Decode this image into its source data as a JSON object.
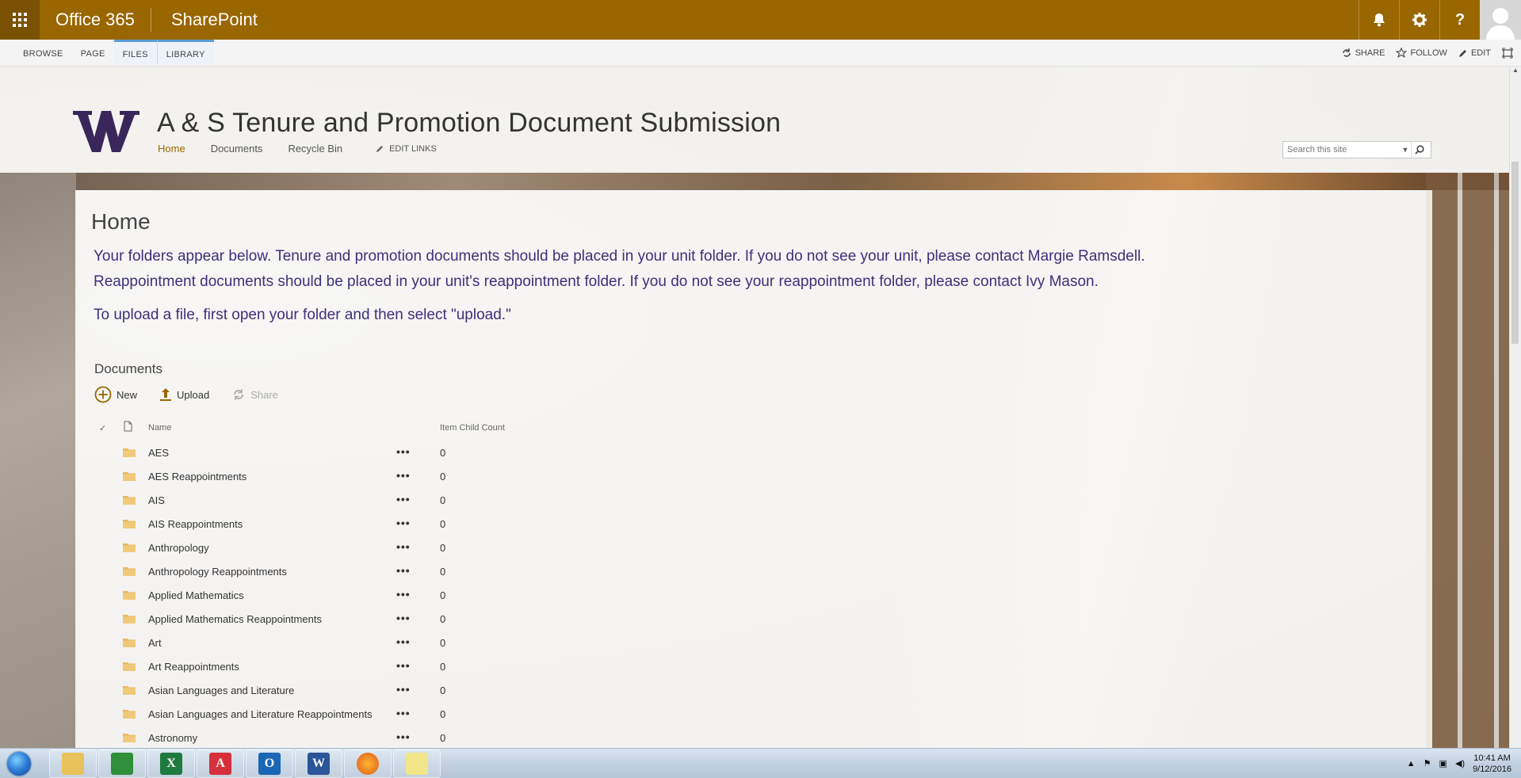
{
  "suitebar": {
    "brand": "Office 365",
    "product": "SharePoint",
    "icons": [
      "bell-icon",
      "gear-icon",
      "help-icon",
      "avatar"
    ],
    "help_label": "?",
    "colors": {
      "bar": "#996600",
      "waffle_bg": "#7a5100"
    }
  },
  "ribbon": {
    "tabs": [
      "BROWSE",
      "PAGE",
      "FILES",
      "LIBRARY"
    ],
    "actions": {
      "share": "SHARE",
      "follow": "FOLLOW",
      "edit": "EDIT"
    }
  },
  "site": {
    "title": "A & S Tenure and Promotion Document Submission",
    "nav": {
      "home": "Home",
      "documents": "Documents",
      "recycle": "Recycle Bin",
      "edit_links": "EDIT LINKS"
    },
    "search_placeholder": "Search this site"
  },
  "page": {
    "title": "Home",
    "intro_line1": "Your folders appear below.  Tenure and promotion documents should be placed in your unit folder. If you do not see your unit, please contact Margie Ramsdell.",
    "intro_line2": "Reappointment documents should be placed in your unit's reappointment folder.  If you do not see your reappointment folder, please contact Ivy Mason.",
    "intro_line3": "To upload a file, first open your folder and then select \"upload.\"",
    "intro_color": "#3f2f7a"
  },
  "documents": {
    "title": "Documents",
    "toolbar": {
      "new": "New",
      "upload": "Upload",
      "share": "Share"
    },
    "columns": {
      "name": "Name",
      "count": "Item Child Count"
    },
    "rows": [
      {
        "name": "AES",
        "count": "0"
      },
      {
        "name": "AES Reappointments",
        "count": "0"
      },
      {
        "name": "AIS",
        "count": "0"
      },
      {
        "name": "AIS Reappointments",
        "count": "0"
      },
      {
        "name": "Anthropology",
        "count": "0"
      },
      {
        "name": "Anthropology Reappointments",
        "count": "0"
      },
      {
        "name": "Applied Mathematics",
        "count": "0"
      },
      {
        "name": "Applied Mathematics Reappointments",
        "count": "0"
      },
      {
        "name": "Art",
        "count": "0"
      },
      {
        "name": "Art Reappointments",
        "count": "0"
      },
      {
        "name": "Asian Languages and Literature",
        "count": "0"
      },
      {
        "name": "Asian Languages and Literature Reappointments",
        "count": "0"
      },
      {
        "name": "Astronomy",
        "count": "0"
      }
    ],
    "row_menu": "•••"
  },
  "taskbar": {
    "apps": [
      "explorer-icon",
      "remote-desktop-icon",
      "excel-icon",
      "acrobat-icon",
      "outlook-icon",
      "word-icon",
      "firefox-icon",
      "sticky-notes-icon"
    ],
    "time": "10:41 AM",
    "date": "9/12/2016"
  }
}
